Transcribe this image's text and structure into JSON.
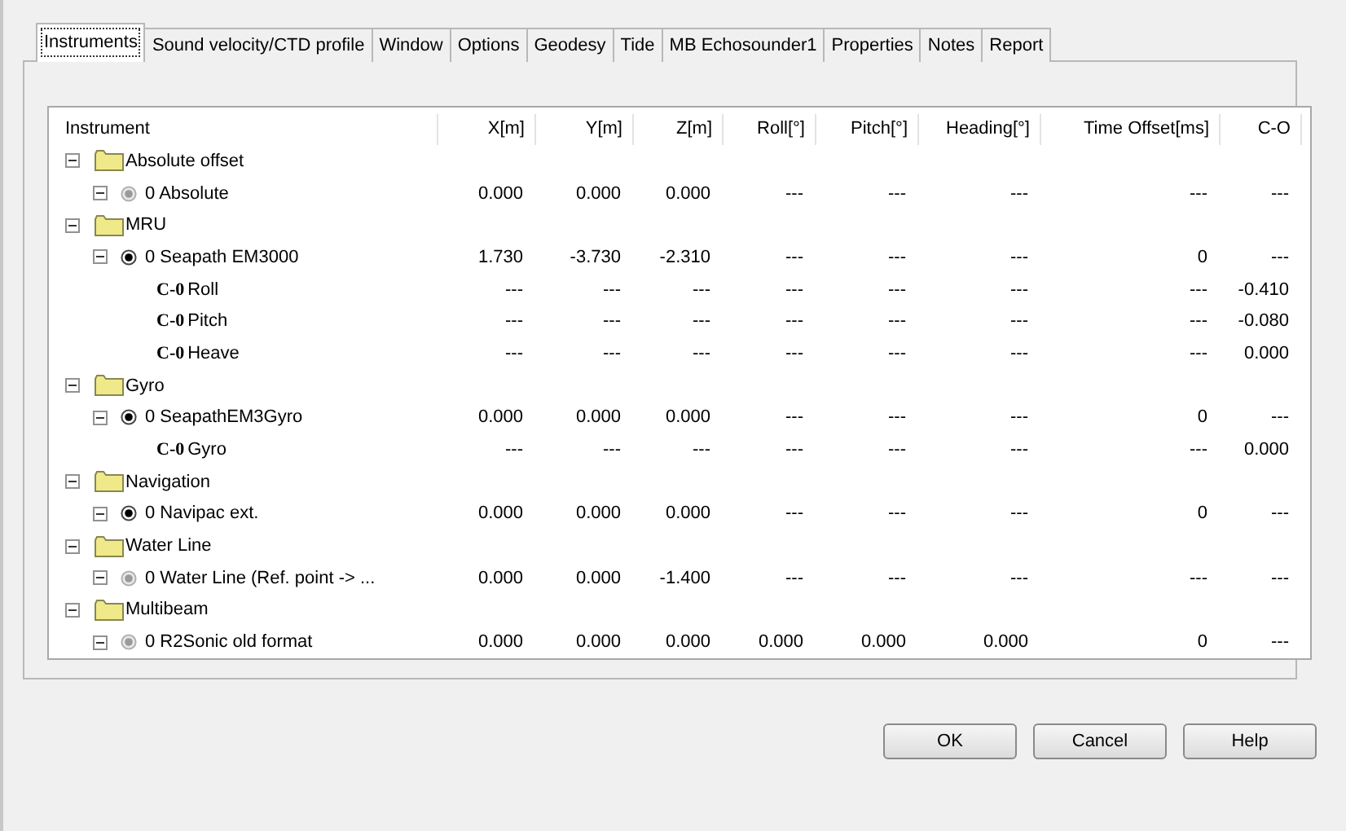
{
  "tabs": [
    {
      "label": "Instruments",
      "selected": true
    },
    {
      "label": "Sound velocity/CTD profile",
      "selected": false
    },
    {
      "label": "Window",
      "selected": false
    },
    {
      "label": "Options",
      "selected": false
    },
    {
      "label": "Geodesy",
      "selected": false
    },
    {
      "label": "Tide",
      "selected": false
    },
    {
      "label": "MB Echosounder1",
      "selected": false
    },
    {
      "label": "Properties",
      "selected": false
    },
    {
      "label": "Notes",
      "selected": false
    },
    {
      "label": "Report",
      "selected": false
    }
  ],
  "table": {
    "columns": [
      "Instrument",
      "X[m]",
      "Y[m]",
      "Z[m]",
      "Roll[°]",
      "Pitch[°]",
      "Heading[°]",
      "Time Offset[ms]",
      "C-O"
    ],
    "rows": [
      {
        "kind": "group",
        "name": "Absolute offset",
        "expanded": true,
        "children": [
          {
            "kind": "instrument",
            "name": "0 Absolute",
            "active": false,
            "expanded": true,
            "cells": [
              "0.000",
              "0.000",
              "0.000",
              "---",
              "---",
              "---",
              "---",
              "---"
            ]
          }
        ]
      },
      {
        "kind": "group",
        "name": "MRU",
        "expanded": true,
        "children": [
          {
            "kind": "instrument",
            "name": "0 Seapath EM3000",
            "active": true,
            "expanded": true,
            "cells": [
              "1.730",
              "-3.730",
              "-2.310",
              "---",
              "---",
              "---",
              "0",
              "---"
            ],
            "children": [
              {
                "kind": "co",
                "badge": "C-0",
                "name": "Roll",
                "cells": [
                  "---",
                  "---",
                  "---",
                  "---",
                  "---",
                  "---",
                  "---",
                  "-0.410"
                ]
              },
              {
                "kind": "co",
                "badge": "C-0",
                "name": "Pitch",
                "cells": [
                  "---",
                  "---",
                  "---",
                  "---",
                  "---",
                  "---",
                  "---",
                  "-0.080"
                ]
              },
              {
                "kind": "co",
                "badge": "C-0",
                "name": "Heave",
                "cells": [
                  "---",
                  "---",
                  "---",
                  "---",
                  "---",
                  "---",
                  "---",
                  "0.000"
                ]
              }
            ]
          }
        ]
      },
      {
        "kind": "group",
        "name": "Gyro",
        "expanded": true,
        "children": [
          {
            "kind": "instrument",
            "name": "0 SeapathEM3Gyro",
            "active": true,
            "expanded": true,
            "cells": [
              "0.000",
              "0.000",
              "0.000",
              "---",
              "---",
              "---",
              "0",
              "---"
            ],
            "children": [
              {
                "kind": "co",
                "badge": "C-0",
                "name": "Gyro",
                "cells": [
                  "---",
                  "---",
                  "---",
                  "---",
                  "---",
                  "---",
                  "---",
                  "0.000"
                ]
              }
            ]
          }
        ]
      },
      {
        "kind": "group",
        "name": "Navigation",
        "expanded": true,
        "children": [
          {
            "kind": "instrument",
            "name": "0 Navipac ext.",
            "active": true,
            "expanded": true,
            "cells": [
              "0.000",
              "0.000",
              "0.000",
              "---",
              "---",
              "---",
              "0",
              "---"
            ]
          }
        ]
      },
      {
        "kind": "group",
        "name": "Water Line",
        "expanded": true,
        "children": [
          {
            "kind": "instrument",
            "name": "0 Water Line (Ref. point -> ...",
            "active": false,
            "expanded": true,
            "cells": [
              "0.000",
              "0.000",
              "-1.400",
              "---",
              "---",
              "---",
              "---",
              "---"
            ]
          }
        ]
      },
      {
        "kind": "group",
        "name": "Multibeam",
        "expanded": true,
        "children": [
          {
            "kind": "instrument",
            "name": "0 R2Sonic old format",
            "active": false,
            "expanded": true,
            "cells": [
              "0.000",
              "0.000",
              "0.000",
              "0.000",
              "0.000",
              "0.000",
              "0",
              "---"
            ]
          }
        ]
      }
    ]
  },
  "buttons": [
    "OK",
    "Cancel",
    "Help"
  ]
}
